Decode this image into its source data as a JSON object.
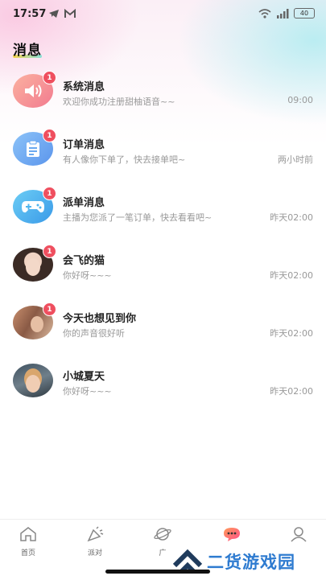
{
  "status_bar": {
    "time": "17:57",
    "battery": "40"
  },
  "page": {
    "title": "消息"
  },
  "messages": [
    {
      "name": "系统消息",
      "preview": "欢迎你成功注册甜柚语音~~",
      "time": "09:00",
      "badge": "1",
      "avatar": "speaker-icon",
      "color": "#f58a8a"
    },
    {
      "name": "订单消息",
      "preview": "有人像你下单了，快去接单吧~",
      "time": "两小时前",
      "badge": "1",
      "avatar": "clipboard-icon",
      "color": "#6aa9f0"
    },
    {
      "name": "派单消息",
      "preview": "主播为您派了一笔订单，快去看看吧~",
      "time": "昨天02:00",
      "badge": "1",
      "avatar": "gamepad-icon",
      "color": "#4fb5ee"
    },
    {
      "name": "会飞的猫",
      "preview": "你好呀~~~",
      "time": "昨天02:00",
      "badge": "1",
      "avatar": "user-photo"
    },
    {
      "name": "今天也想见到你",
      "preview": "你的声音很好听",
      "time": "昨天02:00",
      "badge": "1",
      "avatar": "user-photo"
    },
    {
      "name": "小城夏天",
      "preview": "你好呀~~~",
      "time": "昨天02:00",
      "badge": "",
      "avatar": "user-photo"
    }
  ],
  "tabs": [
    {
      "label": "首页",
      "icon": "home-icon"
    },
    {
      "label": "派对",
      "icon": "party-icon"
    },
    {
      "label": "广",
      "icon": "planet-icon"
    },
    {
      "label": "",
      "icon": "chat-icon"
    },
    {
      "label": "",
      "icon": "profile-icon"
    }
  ],
  "watermark": {
    "text": "二货游戏园"
  }
}
